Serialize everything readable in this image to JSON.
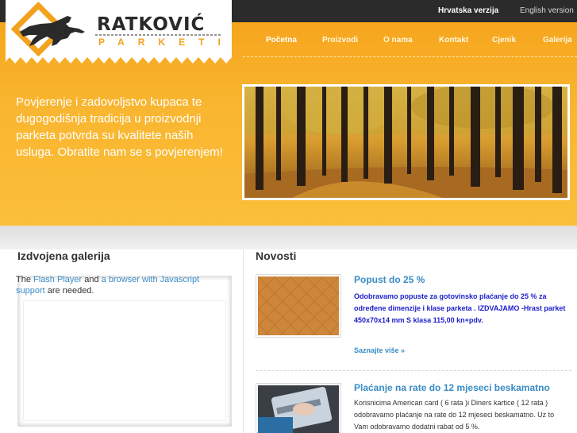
{
  "topbar": {
    "lang_hr": "Hrvatska verzija",
    "lang_en": "English version"
  },
  "logo": {
    "brand": "RATKOVIĆ",
    "sub": "PARKETI"
  },
  "nav": {
    "items": [
      "Početna",
      "Proizvodi",
      "O nama",
      "Kontakt",
      "Cjenik",
      "Galerija"
    ],
    "active": "Početna"
  },
  "hero": {
    "tagline": "Povjerenje i zadovoljstvo kupaca te dugogodišnja tradicija u proizvodnji parketa potvrda su kvalitete naših usluga. Obratite nam se s povjerenjem!"
  },
  "gallery": {
    "title": "Izdvojena galerija",
    "note_prefix": "The",
    "flash_link": "Flash Player",
    "note_and": "and",
    "browser_link": "a browser with Javascript support",
    "note_suffix": "are needed."
  },
  "news": {
    "title": "Novosti",
    "items": [
      {
        "title": "Popust do 25 %",
        "body": "Odobravamo popuste za gotovinsko plaćanje do 25 % za određene dimenzije i klase parketa . IZDVAJAMO -Hrast parket 450x70x14 mm S klasa 115,00 kn+pdv.",
        "more": "Saznajte više »"
      },
      {
        "title": "Plaćanje na rate do 12 mjeseci beskamatno",
        "body": "Korisnicima American card ( 6 rata )i Diners kartice ( 12 rata ) odobravamo plaćanje na rate do 12 mjeseci beskamatno. Uz to Vam odobravamo  dodatni rabat od 5 %."
      }
    ]
  },
  "colors": {
    "orange": "#f9b52f",
    "dark": "#2b2b2b",
    "link": "#3a8cc6"
  }
}
